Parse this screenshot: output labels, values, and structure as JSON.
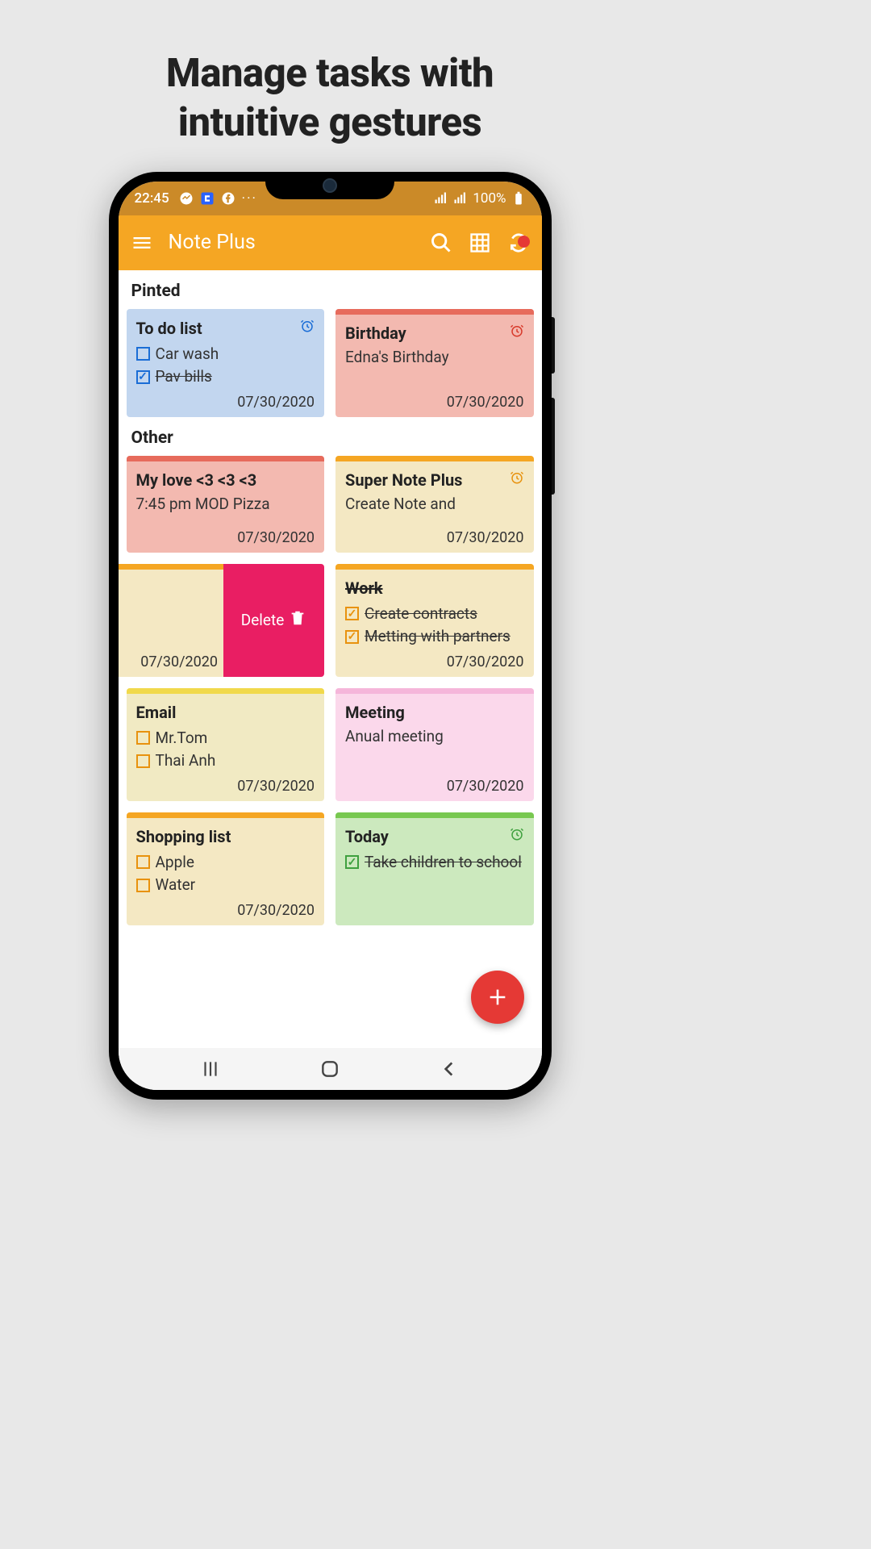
{
  "promo": {
    "line1": "Manage tasks with",
    "line2": "intuitive gestures"
  },
  "status": {
    "time": "22:45",
    "battery": "100%"
  },
  "appbar": {
    "title": "Note Plus"
  },
  "sections": {
    "pinned": "Pinted",
    "other": "Other"
  },
  "swipe": {
    "delete_label": "Delete"
  },
  "notes": {
    "todo": {
      "title": "To do list",
      "items": [
        {
          "text": "Car wash",
          "checked": false
        },
        {
          "text": "Pav bills",
          "checked": true
        }
      ],
      "date": "07/30/2020"
    },
    "birthday": {
      "title": "Birthday",
      "body": "Edna's Birthday",
      "date": "07/30/2020"
    },
    "mylove": {
      "title": "My love <3 <3 <3",
      "body": "7:45 pm MOD Pizza",
      "date": "07/30/2020"
    },
    "supernote": {
      "title": "Super Note Plus",
      "body": "Create Note and",
      "date": "07/30/2020"
    },
    "swiped": {
      "date": "07/30/2020"
    },
    "work": {
      "title": "Work",
      "items": [
        {
          "text": "Create contracts",
          "checked": true
        },
        {
          "text": "Metting with partners",
          "checked": true
        }
      ],
      "date": "07/30/2020"
    },
    "email": {
      "title": "Email",
      "items": [
        {
          "text": "Mr.Tom",
          "checked": false
        },
        {
          "text": "Thai Anh",
          "checked": false
        }
      ],
      "date": "07/30/2020"
    },
    "meeting": {
      "title": "Meeting",
      "body": "Anual meeting",
      "date": "07/30/2020"
    },
    "shopping": {
      "title": "Shopping list",
      "items": [
        {
          "text": "Apple",
          "checked": false
        },
        {
          "text": "Water",
          "checked": false
        }
      ],
      "date": "07/30/2020"
    },
    "today": {
      "title": "Today",
      "items": [
        {
          "text": "Take children to school",
          "checked": true
        }
      ]
    }
  }
}
